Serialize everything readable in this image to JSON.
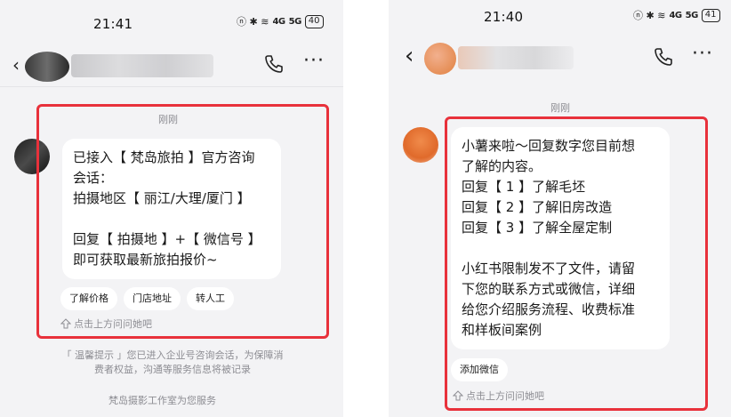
{
  "left": {
    "status": {
      "time": "21:41",
      "icons": "ⓝ ✱ ≋",
      "signal1": "4G",
      "signal2": "5G",
      "battery": "40"
    },
    "header": {
      "phone_icon": "phone-icon",
      "more": "···"
    },
    "timestamp": "刚刚",
    "message_lines": [
      "已接入【 梵岛旅拍 】官方咨询",
      "会话：",
      "拍摄地区【 丽江/大理/厦门 】",
      "",
      "回复【 拍摄地 】+【 微信号 】",
      "即可获取最新旅拍报价~"
    ],
    "quick_replies": [
      "了解价格",
      "门店地址",
      "转人工"
    ],
    "hint": "点击上方问问她吧",
    "notice_lines": [
      "「 温馨提示 」您已进入企业号咨询会话，为保障消",
      "费者权益，沟通等服务信息将被记录"
    ],
    "footer": "梵岛摄影工作室为您服务",
    "highlight_color": "#e8313b"
  },
  "right": {
    "status": {
      "time": "21:40",
      "icons": "ⓝ ✱ ≋",
      "signal1": "4G",
      "signal2": "5G",
      "battery": "41"
    },
    "header": {
      "back": "‹",
      "phone_icon": "phone-icon",
      "more": "···"
    },
    "timestamp": "刚刚",
    "message_lines": [
      "小薯来啦～回复数字您目前想",
      "了解的内容。",
      "回复【 1 】了解毛坯",
      "回复【 2 】了解旧房改造",
      "回复【 3 】了解全屋定制",
      "",
      "小红书限制发不了文件，请留",
      "下您的联系方式或微信，详细",
      "给您介绍服务流程、收费标准",
      "和样板间案例"
    ],
    "quick_replies": [
      "添加微信"
    ],
    "hint": "点击上方问问她吧",
    "highlight_color": "#e8313b"
  }
}
